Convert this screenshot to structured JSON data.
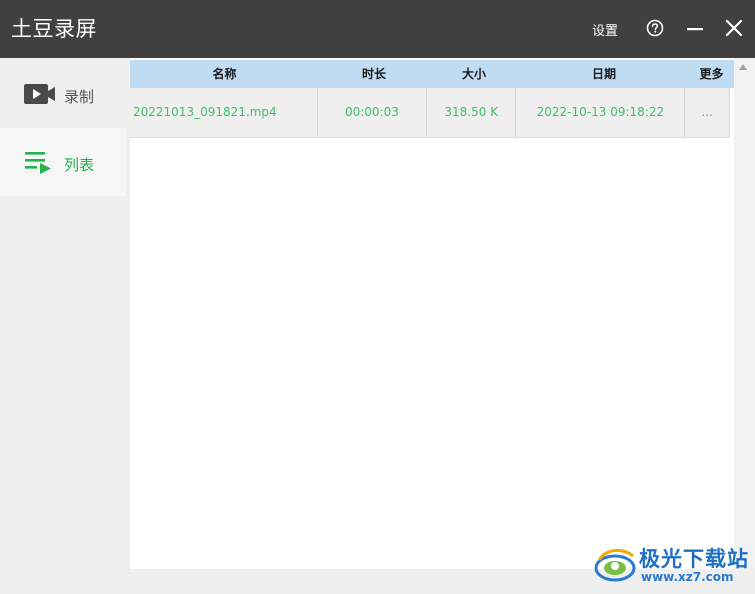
{
  "app": {
    "title": "土豆录屏",
    "settings_label": "设置"
  },
  "icons": {
    "help": "help-circle-icon",
    "minimize": "minimize-icon",
    "close": "close-icon",
    "record": "video-camera-icon",
    "list": "playlist-icon"
  },
  "sidebar": {
    "items": [
      {
        "label": "录制",
        "active": false
      },
      {
        "label": "列表",
        "active": true
      }
    ]
  },
  "table": {
    "headers": [
      "名称",
      "时长",
      "大小",
      "日期",
      "更多"
    ],
    "rows": [
      {
        "name": "20221013_091821.mp4",
        "duration": "00:00:03",
        "size": "318.50 K",
        "date": "2022-10-13 09:18:22",
        "more": "..."
      }
    ]
  },
  "watermark": {
    "brand": "极光下载站",
    "url": "www.xz7.com"
  },
  "colors": {
    "titlebar": "#404040",
    "accent": "#22b44c",
    "header_bg": "#c0dcf2",
    "row_text": "#3fbf6a"
  }
}
